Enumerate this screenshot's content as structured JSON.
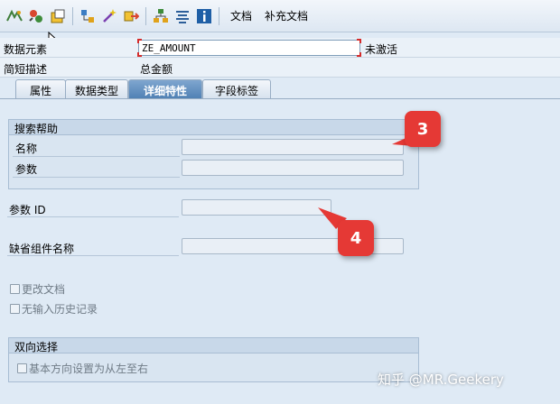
{
  "toolbar": {
    "doc_label": "文档",
    "supp_doc_label": "补充文档"
  },
  "header": {
    "data_element_label": "数据元素",
    "data_element_value": "ZE_AMOUNT",
    "status": "未激活",
    "short_desc_label": "简短描述",
    "short_desc_value": "总金额"
  },
  "tabs": [
    {
      "label": "属性",
      "active": false
    },
    {
      "label": "数据类型",
      "active": false
    },
    {
      "label": "详细特性",
      "active": true
    },
    {
      "label": "字段标签",
      "active": false
    }
  ],
  "search_help": {
    "title": "搜索帮助",
    "name_label": "名称",
    "param_label": "参数"
  },
  "param_id_label": "参数 ID",
  "default_component_label": "缺省组件名称",
  "checkboxes": {
    "change_doc": "更改文档",
    "no_history": "无输入历史记录"
  },
  "bidi": {
    "title": "双向选择",
    "rtl_label": "基本方向设置为从左至右"
  },
  "callouts": {
    "c3": "3",
    "c4": "4"
  },
  "watermark": "知乎 @MR.Geekery",
  "colors": {
    "callout": "#e53935",
    "active_tab": "#4e7fb3",
    "background": "#dfeaf5"
  }
}
